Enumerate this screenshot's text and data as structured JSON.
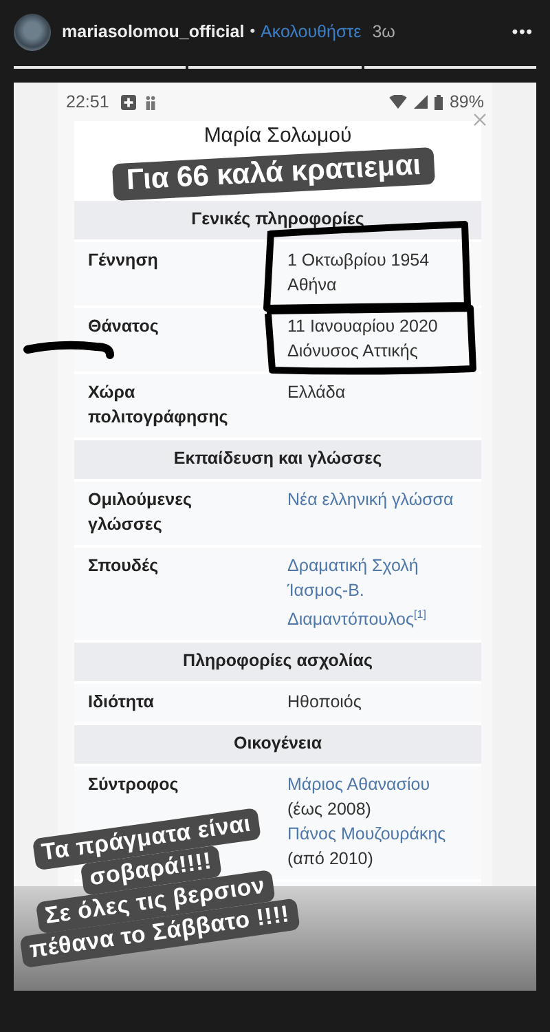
{
  "post": {
    "username": "mariasolomou_official",
    "separator": "•",
    "follow": "Ακολουθήστε",
    "age": "3ω",
    "more": "•••"
  },
  "progress": [
    {
      "level": 1
    },
    {
      "level": 1
    },
    {
      "level": 1
    }
  ],
  "status_bar": {
    "time": "22:51",
    "battery": "89%"
  },
  "infobox": {
    "title": "Μαρία Σολωμού",
    "sections": [
      {
        "heading": "Γενικές πληροφορίες",
        "rows": [
          {
            "label": "Γέννηση",
            "values": [
              {
                "text": "1 Οκτωβρίου 1954",
                "link": false
              },
              {
                "text": "Αθήνα",
                "link": false
              }
            ]
          },
          {
            "label": "Θάνατος",
            "values": [
              {
                "text": "11 Ιανουαρίου 2020",
                "link": false
              },
              {
                "text": "Διόνυσος Αττικής",
                "link": false
              }
            ]
          },
          {
            "label": "Χώρα πολιτογράφησης",
            "values": [
              {
                "text": "Ελλάδα",
                "link": false
              }
            ]
          }
        ]
      },
      {
        "heading": "Εκπαίδευση και γλώσσες",
        "rows": [
          {
            "label": "Ομιλούμενες γλώσσες",
            "values": [
              {
                "text": "Νέα ελληνική γλώσσα",
                "link": true
              }
            ]
          },
          {
            "label": "Σπουδές",
            "values": [
              {
                "text": "Δραματική Σχολή",
                "link": true
              },
              {
                "text": "Ίασμος-Β.",
                "link": true
              },
              {
                "text": "Διαμαντόπουλος$^{[1]}$",
                "link": true
              }
            ]
          }
        ]
      },
      {
        "heading": "Πληροφορίες ασχολίας",
        "rows": [
          {
            "label": "Ιδιότητα",
            "values": [
              {
                "text": "Ηθοποιός",
                "link": false
              }
            ]
          }
        ]
      },
      {
        "heading": "Οικογένεια",
        "rows": [
          {
            "label": "Σύντροφος",
            "values": [
              {
                "text": "Μάριος Αθανασίου",
                "link": true
              },
              {
                "text": "(έως 2008)",
                "link": false
              },
              {
                "text": "Πάνος Μουζουράκης",
                "link": true
              },
              {
                "text": "(από 2010)",
                "link": false
              }
            ]
          }
        ]
      }
    ]
  },
  "stickers": [
    {
      "kind": "title",
      "lines": [
        "Για 66 καλά κρατιεμαι"
      ]
    },
    {
      "kind": "note",
      "lines": [
        "Τα πράγματα είναι",
        "σοβαρά!!!!",
        "Σε όλες τις βερσιον",
        "πέθανα το Σάββατο !!!!"
      ]
    }
  ]
}
